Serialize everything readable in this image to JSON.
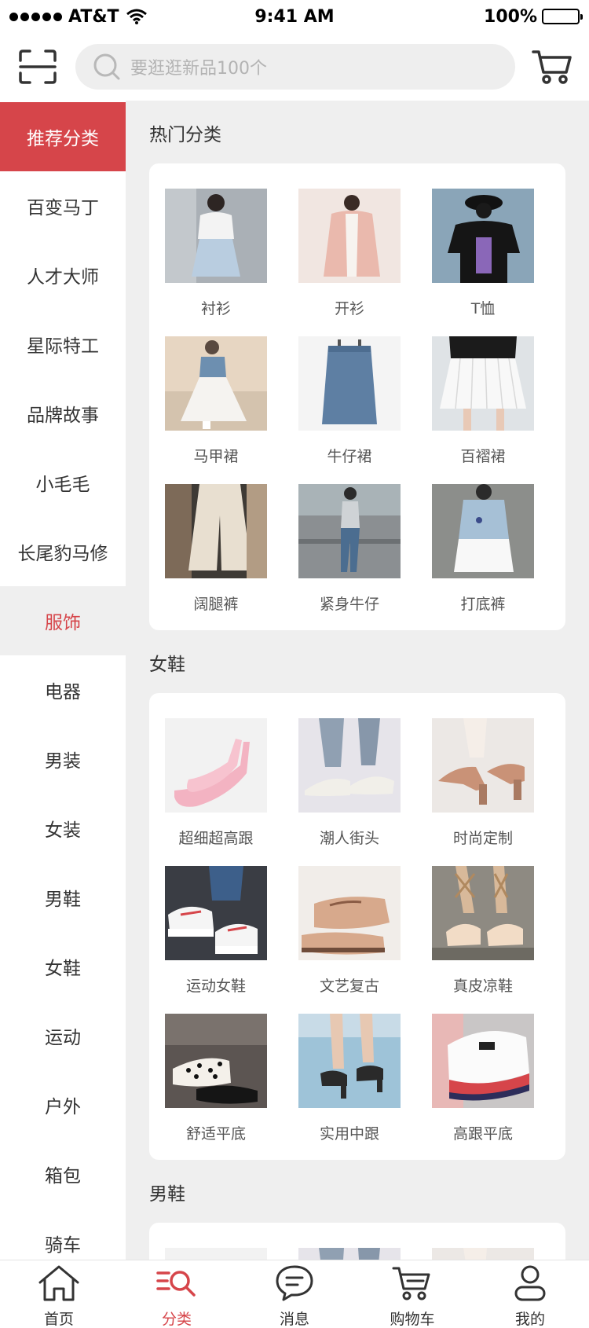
{
  "status_bar": {
    "carrier": "AT&T",
    "time": "9:41 AM",
    "battery": "100%"
  },
  "header": {
    "search_placeholder": "要逛逛新品100个"
  },
  "sidebar": {
    "items": [
      "推荐分类",
      "百变马丁",
      "人才大师",
      "星际特工",
      "品牌故事",
      "小毛毛",
      "长尾豹马修",
      "服饰",
      "电器",
      "男装",
      "女装",
      "男鞋",
      "女鞋",
      "运动",
      "户外",
      "箱包",
      "骑车"
    ],
    "active_index": 0,
    "highlight_index": 7
  },
  "sections": [
    {
      "title": "热门分类",
      "items": [
        {
          "label": "衬衫",
          "thumb": "skirt-blouse"
        },
        {
          "label": "开衫",
          "thumb": "pink-cardigan"
        },
        {
          "label": "T恤",
          "thumb": "black-tee"
        },
        {
          "label": "马甲裙",
          "thumb": "tulle-dress"
        },
        {
          "label": "牛仔裙",
          "thumb": "denim-skirt"
        },
        {
          "label": "百褶裙",
          "thumb": "pleated-skirt"
        },
        {
          "label": "阔腿裤",
          "thumb": "wide-pants"
        },
        {
          "label": "紧身牛仔",
          "thumb": "skinny-jeans"
        },
        {
          "label": "打底裤",
          "thumb": "shorts"
        }
      ]
    },
    {
      "title": "女鞋",
      "items": [
        {
          "label": "超细超高跟",
          "thumb": "pink-heels"
        },
        {
          "label": "潮人街头",
          "thumb": "street-flats"
        },
        {
          "label": "时尚定制",
          "thumb": "block-heels"
        },
        {
          "label": "运动女鞋",
          "thumb": "sneakers"
        },
        {
          "label": "文艺复古",
          "thumb": "retro-flats"
        },
        {
          "label": "真皮凉鞋",
          "thumb": "lace-sandals"
        },
        {
          "label": "舒适平底",
          "thumb": "dotted-mules"
        },
        {
          "label": "实用中跟",
          "thumb": "mid-heels"
        },
        {
          "label": "高跟平底",
          "thumb": "platform-sneakers"
        }
      ]
    },
    {
      "title": "男鞋",
      "items": [
        {
          "label": "",
          "thumb": "pink-heels"
        },
        {
          "label": "",
          "thumb": "street-flats"
        },
        {
          "label": "",
          "thumb": "block-heels"
        }
      ]
    }
  ],
  "tabbar": {
    "items": [
      {
        "label": "首页",
        "icon": "home-icon"
      },
      {
        "label": "分类",
        "icon": "category-search-icon"
      },
      {
        "label": "消息",
        "icon": "message-icon"
      },
      {
        "label": "购物车",
        "icon": "cart-icon"
      },
      {
        "label": "我的",
        "icon": "user-icon"
      }
    ],
    "active_index": 1
  },
  "colors": {
    "accent": "#d6454a",
    "panel_bg": "#efefef"
  }
}
